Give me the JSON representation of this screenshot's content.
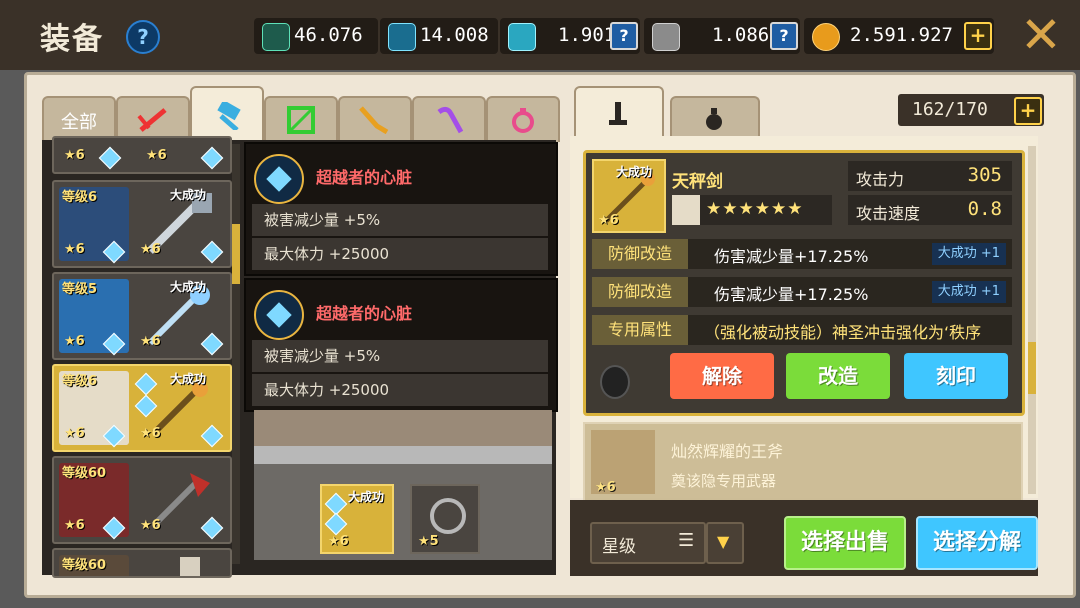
{
  "header": {
    "title": "装备",
    "help_label": "?",
    "close_label": "✕"
  },
  "currencies": [
    {
      "icon": "crystal-cluster-icon",
      "value": "46.076"
    },
    {
      "icon": "blue-gem-icon",
      "value": "14.008"
    },
    {
      "icon": "cyan-cube-icon",
      "value": "1.901"
    },
    {
      "icon": "stone-icon",
      "value": "1.086"
    },
    {
      "icon": "gold-coin-icon",
      "value": "2.591.927"
    }
  ],
  "colors": {
    "accent_gold": "#d9b23b",
    "btn_red": "#ff6b45",
    "btn_green": "#7bdc3a",
    "btn_blue": "#3fc6ff"
  },
  "tabs": [
    {
      "label": "全部",
      "icon": null
    },
    {
      "label": "",
      "icon": "sword-icon"
    },
    {
      "label": "",
      "icon": "hammer-icon"
    },
    {
      "label": "",
      "icon": "bow-icon"
    },
    {
      "label": "",
      "icon": "gun-icon"
    },
    {
      "label": "",
      "icon": "staff-icon"
    },
    {
      "label": "",
      "icon": "orb-icon"
    }
  ],
  "active_tab_index": 2,
  "detail_tabs": [
    {
      "icon": "weapon-tab-icon"
    },
    {
      "icon": "accessory-tab-icon"
    }
  ],
  "inventory_count": "162/170",
  "item_list": [
    {
      "level": "",
      "star_left": "6",
      "star_right": "6",
      "badge": ""
    },
    {
      "level": "等级6",
      "star_left": "6",
      "star_right": "6",
      "badge": "大成功"
    },
    {
      "level": "等级5",
      "star_left": "6",
      "star_right": "6",
      "badge": "大成功"
    },
    {
      "level": "等级6",
      "star_left": "6",
      "star_right": "6",
      "badge": "大成功"
    },
    {
      "level": "等级60",
      "star_left": "6",
      "star_right": "6",
      "badge": ""
    },
    {
      "level": "等级60",
      "star_left": "",
      "star_right": "",
      "badge": ""
    }
  ],
  "tooltips": [
    {
      "name": "超越者的心脏",
      "line1": "被害减少量 +5%",
      "line2": "最大体力 +25000"
    },
    {
      "name": "超越者的心脏",
      "line1": "被害减少量 +5%",
      "line2": "最大体力 +25000"
    }
  ],
  "scene": {
    "slot_main_badge": "大成功",
    "slot_main_star": "6",
    "slot_second_star": "5"
  },
  "detail": {
    "badge": "大成功",
    "name": "天秤剑",
    "star": "6",
    "stars_row": "★★★★★★",
    "attack_label": "攻击力",
    "attack_value": "305",
    "speed_label": "攻击速度",
    "speed_value": "0.8",
    "affixes": [
      {
        "key": "防御改造",
        "value": "伤害减少量+17.25%",
        "badge": "大成功 +1"
      },
      {
        "key": "防御改造",
        "value": "伤害减少量+17.25%",
        "badge": "大成功 +1"
      },
      {
        "key": "专用属性",
        "value": "（强化被动技能）神圣冲击强化为‘秩序",
        "badge": ""
      }
    ],
    "buttons": {
      "unequip": "解除",
      "modify": "改造",
      "engrave": "刻印"
    }
  },
  "next_card": {
    "name": "灿然辉耀的王斧",
    "subtitle": "奠该隐专用武器",
    "star": "6"
  },
  "sort": {
    "selected": "星级"
  },
  "bottom_buttons": {
    "sell": "选择出售",
    "dismantle": "选择分解"
  }
}
